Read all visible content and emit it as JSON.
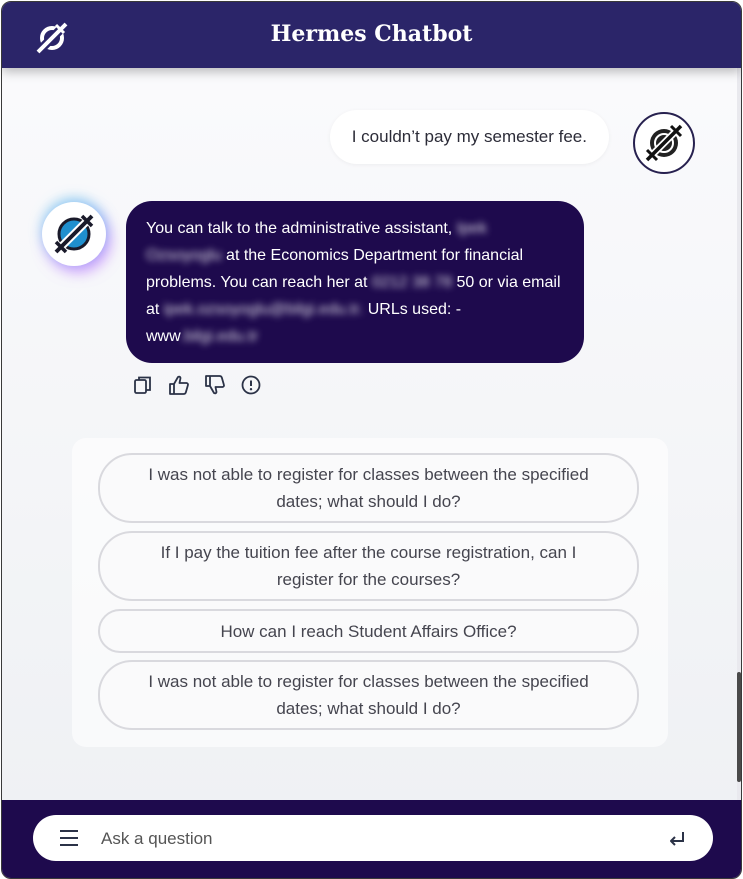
{
  "header": {
    "title": "Hermes Chatbot",
    "logo_icon": "plug-cross-logo-icon"
  },
  "conversation": {
    "user_message": "I couldn’t pay my semester fee.",
    "bot_message": {
      "part1": "You can talk to the administrative assistant,",
      "redacted_name": "Ipek Ozsoyoglu",
      "part2": "at the Economics Department for financial problems. You can reach her at",
      "redacted_phone": "0212 38 78",
      "part3": "50 or via email at",
      "redacted_email": "ipek.ozsoyoglu@bilgi.edu.tr.",
      "part4": "URLs used: - www",
      "redacted_url": ".bilgi.edu.tr"
    },
    "actions": [
      "copy-icon",
      "thumbs-up-icon",
      "thumbs-down-icon",
      "report-icon"
    ]
  },
  "suggestions": [
    "I was not able to register for classes between the specified dates; what should I do?",
    "If I pay the tuition fee after the course registration, can I register for the courses?",
    "How can I reach Student Affairs Office?",
    "I was not able to register for classes between the specified dates; what should I do?"
  ],
  "input": {
    "placeholder": "Ask a question",
    "value": ""
  },
  "colors": {
    "header_bg": "#2b2569",
    "footer_bg": "#1e0a4d",
    "bot_bubble_bg": "#1e0a4d",
    "avatar_accent": "#1f8fce"
  }
}
